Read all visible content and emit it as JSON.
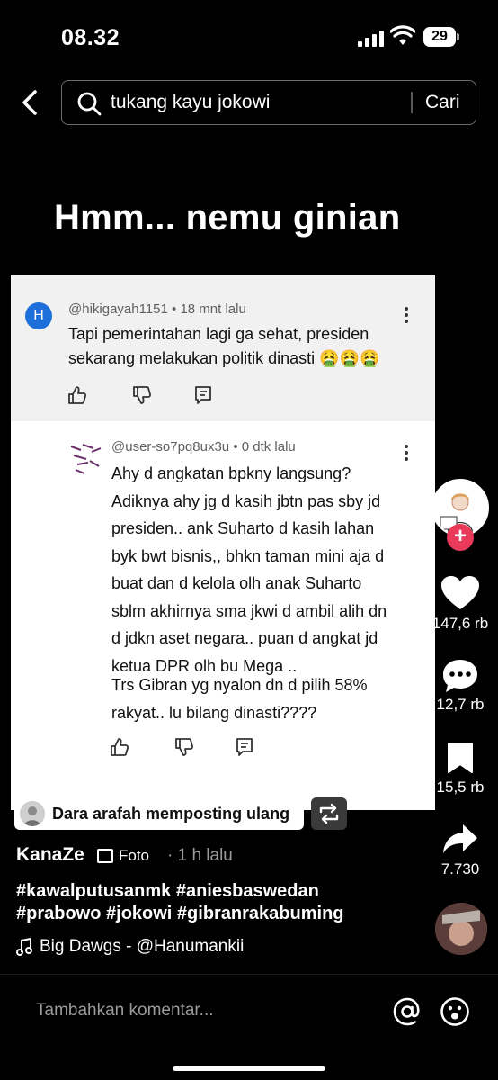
{
  "status_bar": {
    "time": "08.32",
    "battery": "29"
  },
  "search": {
    "query": "tukang kayu jokowi",
    "button_label": "Cari"
  },
  "post": {
    "headline": "Hmm... nemu ginian",
    "author": "KanaZe",
    "media_type": "Foto",
    "time_ago": "· 1 h lalu",
    "hashtags": "#kawalputusanmk #aniesbaswedan #prabowo #jokowi #gibranrakabuming",
    "music": "Big Dawgs - @Hanumankii",
    "repost_text": "Dara arafah memposting ulang"
  },
  "embedded_comments": {
    "first": {
      "avatar_letter": "H",
      "username": "@hikigayah1151",
      "time": "• 18 mnt lalu",
      "text": "Tapi pemerintahan lagi ga sehat, presiden sekarang melakukan politik dinasti 🤮🤮🤮"
    },
    "reply": {
      "username": "@user-so7pq8ux3u",
      "time": "• 0 dtk lalu",
      "paragraph1": "Ahy d angkatan bpkny langsung? Adiknya ahy jg d kasih jbtn pas sby jd presiden.. ank Suharto d kasih lahan byk bwt bisnis,, bhkn taman mini aja d buat dan d kelola olh anak Suharto sblm akhirnya sma jkwi d ambil alih dn d jdkn aset negara.. puan d angkat jd ketua DPR olh bu Mega ..",
      "paragraph2": "Trs Gibran yg nyalon dn d pilih 58% rakyat.. lu bilang dinasti????"
    }
  },
  "side_actions": {
    "likes": "147,6 rb",
    "comments": "12,7 rb",
    "saves": "15,5 rb",
    "shares": "7.730"
  },
  "comment_input": {
    "placeholder": "Tambahkan komentar..."
  },
  "colors": {
    "background": "#000000",
    "follow_button": "#ea3a5a",
    "avatar_h": "#1e6fd9"
  },
  "icons": [
    "back-arrow-icon",
    "search-icon",
    "heart-icon",
    "comment-icon",
    "bookmark-icon",
    "share-icon",
    "repost-icon",
    "at-icon",
    "emoji-icon",
    "music-note-icon",
    "photo-icon"
  ]
}
